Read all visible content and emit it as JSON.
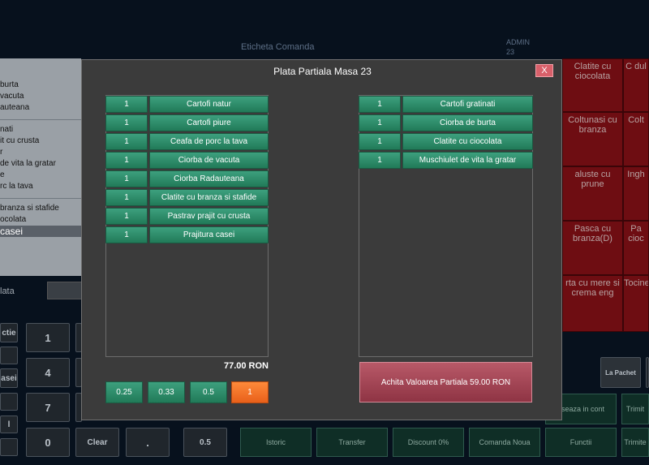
{
  "background": {
    "header_label": "Eticheta Comanda",
    "admin_label": "ADMIN",
    "table_no": "23",
    "left_items": [
      "burta",
      "vacuta",
      "auteana",
      "nati",
      "it cu crusta",
      "r",
      "de vita la gratar",
      "e",
      "rc la tava",
      "branza si stafide",
      "ocolata"
    ],
    "left_selected": "casei",
    "data_label": "lata",
    "product_tiles": [
      {
        "label": "Clatite cu ciocolata"
      },
      {
        "label": "C dul"
      },
      {
        "label": "Coltunasi cu branza"
      },
      {
        "label": "Colt"
      },
      {
        "label": "aluste cu prune"
      },
      {
        "label": "Ingh"
      },
      {
        "label": "Pasca cu branza(D)"
      },
      {
        "label": "Pa cioc"
      },
      {
        "label": "rta cu mere si crema eng"
      },
      {
        "label": "Tocine"
      }
    ],
    "keypad": {
      "k1": "1",
      "k4": "4",
      "k7": "7",
      "k0": "0",
      "clear": "Clear",
      "dot": ".",
      "half": "0.5",
      "side1": "ctie",
      "side2": "asei",
      "side3": "l"
    },
    "buttons": {
      "la_pachet": "La Pachet",
      "aseaza_in_cont": "aseaza in cont",
      "trimite1": "Trimit",
      "istoric": "Istoric",
      "transfer": "Transfer",
      "discount": "Discount 0%",
      "comanda_noua": "Comanda Noua",
      "functii": "Functii",
      "trimite2": "Trimite"
    }
  },
  "modal": {
    "title": "Plata Partiala Masa 23",
    "close_label": "X",
    "left_items": [
      {
        "qty": "1",
        "name": "Cartofi natur"
      },
      {
        "qty": "1",
        "name": "Cartofi piure"
      },
      {
        "qty": "1",
        "name": "Ceafa de porc la tava"
      },
      {
        "qty": "1",
        "name": "Ciorba de vacuta"
      },
      {
        "qty": "1",
        "name": "Ciorba Radauteana"
      },
      {
        "qty": "1",
        "name": "Clatite cu branza si stafide"
      },
      {
        "qty": "1",
        "name": "Pastrav prajit cu crusta"
      },
      {
        "qty": "1",
        "name": "Prajitura casei"
      }
    ],
    "right_items": [
      {
        "qty": "1",
        "name": "Cartofi gratinati"
      },
      {
        "qty": "1",
        "name": "Ciorba de burta"
      },
      {
        "qty": "1",
        "name": "Clatite cu ciocolata"
      },
      {
        "qty": "1",
        "name": "Muschiulet de vita la gratar"
      }
    ],
    "total": "77.00 RON",
    "fractions": [
      "0.25",
      "0.33",
      "0.5",
      "1"
    ],
    "selected_fraction": "1",
    "pay_button": "Achita Valoarea Partiala 59.00 RON"
  }
}
